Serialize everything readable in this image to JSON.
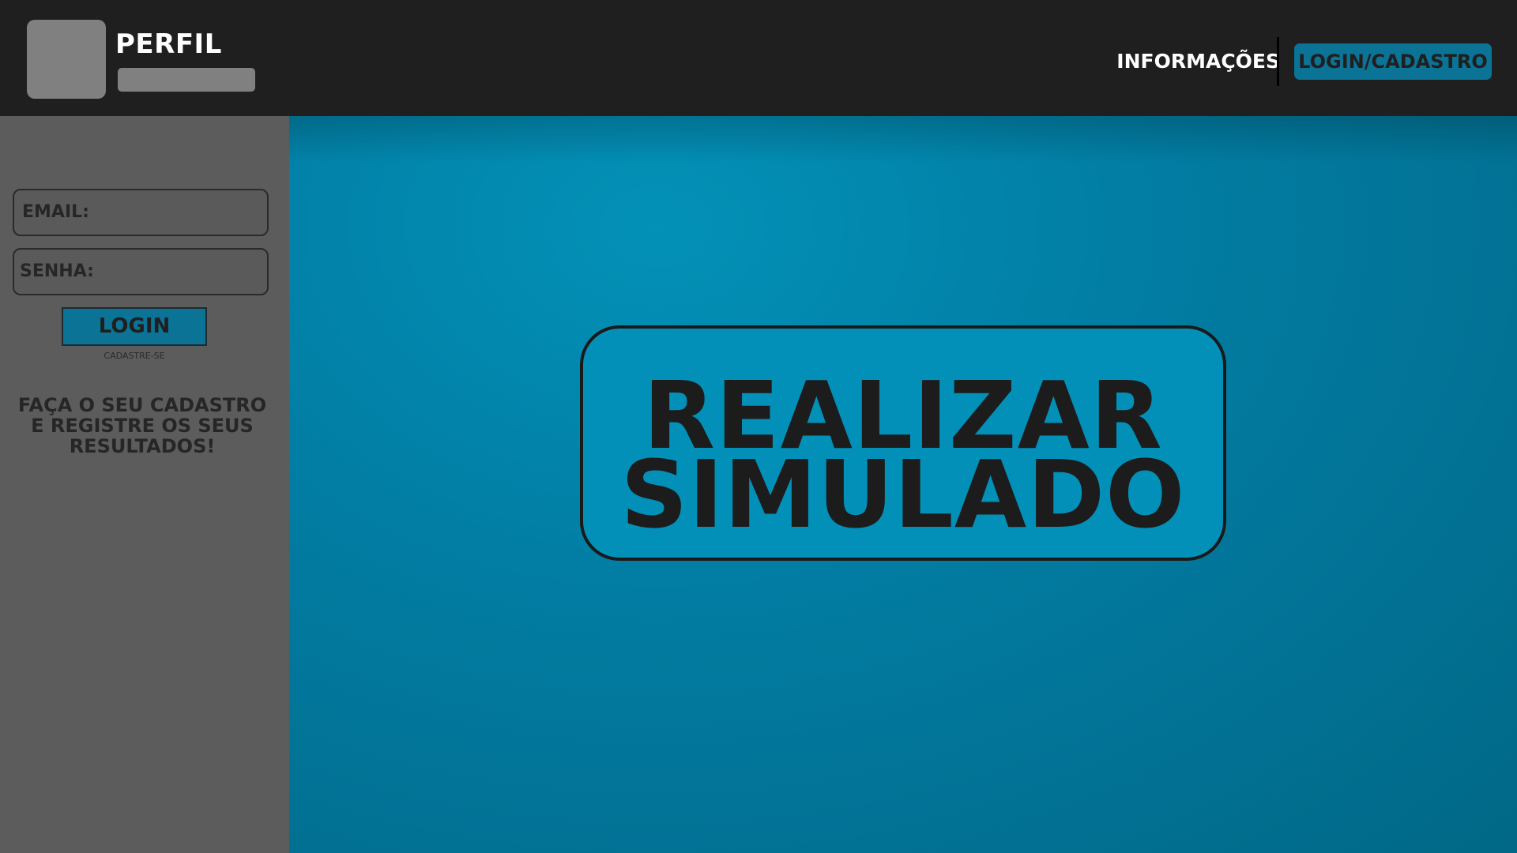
{
  "header": {
    "profile_title": "Perfil",
    "nav_info_label": "Informações",
    "nav_login_label": "Login/Cadastro"
  },
  "sidebar": {
    "email_placeholder": "Email:",
    "senha_placeholder": "Senha:",
    "login_label": "Login",
    "signup_label": "Cadastre-se",
    "promo_line_1": "Faça o seu cadastro",
    "promo_line_2": "e registre os seus",
    "promo_line_3": "resultados!"
  },
  "main": {
    "cta_line_1": "Realizar",
    "cta_line_2": "Simulado"
  },
  "colors": {
    "header_bg": "#1f1f1f",
    "sidebar_bg": "#5c5c5c",
    "accent": "#0a7396",
    "main_bg": "#027da3",
    "placeholder_gray": "#808080"
  }
}
